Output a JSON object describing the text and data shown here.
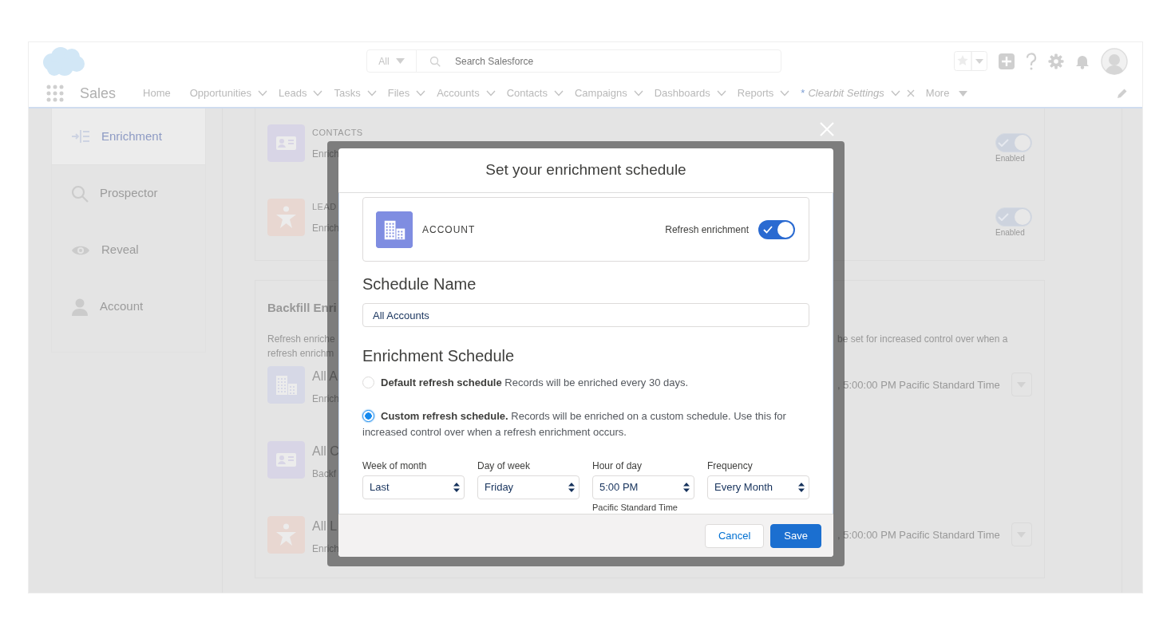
{
  "header": {
    "search": {
      "scope": "All",
      "placeholder": "Search Salesforce"
    },
    "app_name": "Sales",
    "nav": [
      {
        "label": "Home",
        "kind": "link"
      },
      {
        "label": "Opportunities",
        "kind": "menu"
      },
      {
        "label": "Leads",
        "kind": "menu"
      },
      {
        "label": "Tasks",
        "kind": "menu"
      },
      {
        "label": "Files",
        "kind": "menu"
      },
      {
        "label": "Accounts",
        "kind": "menu"
      },
      {
        "label": "Contacts",
        "kind": "menu"
      },
      {
        "label": "Campaigns",
        "kind": "menu"
      },
      {
        "label": "Dashboards",
        "kind": "menu"
      },
      {
        "label": "Reports",
        "kind": "menu"
      },
      {
        "label": "Clearbit Settings",
        "kind": "temp",
        "marker": "*"
      },
      {
        "label": "More",
        "kind": "more"
      }
    ]
  },
  "sidebar": {
    "items": [
      {
        "label": "Enrichment",
        "selected": true
      },
      {
        "label": "Prospector",
        "selected": false
      },
      {
        "label": "Reveal",
        "selected": false
      },
      {
        "label": "Account",
        "selected": false
      }
    ]
  },
  "objects": [
    {
      "kind": "contact",
      "title": "CONTACTS",
      "subtitle": "Enrich",
      "toggle": {
        "on": true,
        "label": "Enabled"
      }
    },
    {
      "kind": "lead",
      "title": "LEAD",
      "subtitle": "Enrich",
      "toggle": {
        "on": true,
        "label": "Enabled"
      }
    }
  ],
  "backfill": {
    "title": "Backfill Enri",
    "description_left": [
      "Refresh enriche",
      "refresh enrichm"
    ],
    "description_right": "be set for increased control over when a",
    "schedules": [
      {
        "kind": "account",
        "name": "All A",
        "subtitle": "Enrich",
        "time": ", 5:00:00 PM Pacific Standard Time"
      },
      {
        "kind": "contact",
        "name": "All C",
        "subtitle": "Backf"
      },
      {
        "kind": "lead",
        "name": "All L",
        "subtitle": "Enrich",
        "time": ", 5:00:00 PM Pacific Standard Time"
      }
    ]
  },
  "modal": {
    "title": "Set your enrichment schedule",
    "object": {
      "kind": "account",
      "label": "ACCOUNT",
      "toggle_label": "Refresh enrichment",
      "on": true
    },
    "schedule_name": {
      "heading": "Schedule Name",
      "value": "All Accounts"
    },
    "schedule_heading": "Enrichment Schedule",
    "options": [
      {
        "text": "**Default refresh schedule** Records will be enriched every 30 days.",
        "selected": false
      },
      {
        "text": "**Custom refresh schedule.** Records will be enriched on a custom schedule. Use this for increased control over when a refresh enrichment occurs.",
        "selected": true
      }
    ],
    "fields": [
      {
        "label": "Week of month",
        "value": "Last"
      },
      {
        "label": "Day of week",
        "value": "Friday"
      },
      {
        "label": "Hour of day",
        "value": "5:00 PM",
        "note": "Pacific Standard Time"
      },
      {
        "label": "Frequency",
        "value": "Every Month"
      }
    ],
    "buttons": [
      {
        "label": "Cancel",
        "kind": "neutral"
      },
      {
        "label": "Save",
        "kind": "brand"
      }
    ]
  }
}
